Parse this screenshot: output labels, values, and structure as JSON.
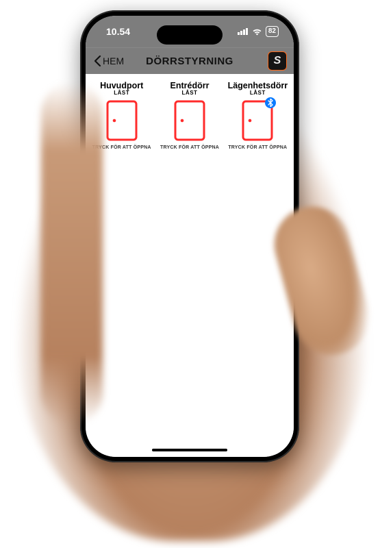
{
  "status": {
    "time": "10.54",
    "battery": "82"
  },
  "nav": {
    "back_label": "HEM",
    "title": "DÖRRSTYRNING",
    "logo_letter": "S"
  },
  "doors": [
    {
      "title": "Huvudport",
      "status": "LÅST",
      "hint": "TRYCK FÖR ATT ÖPPNA",
      "bluetooth": false
    },
    {
      "title": "Entrédörr",
      "status": "LÅST",
      "hint": "TRYCK FÖR ATT ÖPPNA",
      "bluetooth": false
    },
    {
      "title": "Lägenhetsdörr",
      "status": "LÅST",
      "hint": "TRYCK FÖR ATT ÖPPNA",
      "bluetooth": true
    }
  ],
  "colors": {
    "door_stroke": "#ff2b2b",
    "chrome": "#7d7d7d",
    "bluetooth": "#0a7bff"
  }
}
